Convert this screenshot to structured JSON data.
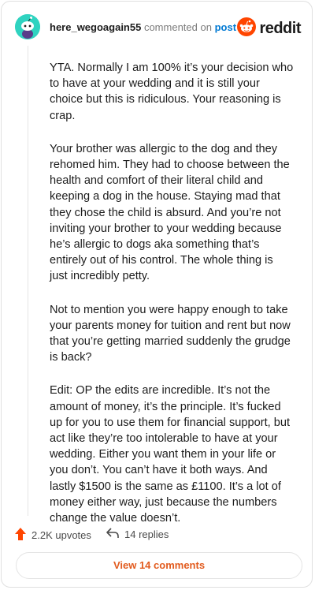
{
  "header": {
    "username": "here_wegoagain55",
    "commented_on": "commented on",
    "post_link": "post",
    "brand": "reddit",
    "avatar_icon": "snoo-avatar-icon",
    "brand_icon": "reddit-logo-icon",
    "colors": {
      "avatar_bg": "#2fd3c0",
      "brand_orange": "#ff4500",
      "link_blue": "#0079d3"
    }
  },
  "comment": {
    "paragraphs": [
      "YTA. Normally I am 100% it’s your decision who to have at your wedding and it is still your choice but this is ridiculous. Your reasoning is crap.",
      "Your brother was allergic to the dog and they rehomed him. They had to choose between the health and comfort of their literal child and keeping a dog in the house. Staying mad that they chose the child is absurd. And you’re not inviting your brother to your wedding because he’s allergic to dogs aka something that’s entirely out of his control. The whole thing is just incredibly petty.",
      "Not to mention you were happy enough to take your parents money for tuition and rent but now that you’re getting married suddenly the grudge is back?",
      "Edit: OP the edits are incredible. It’s not the amount of money, it’s the principle. It’s fucked up for you to use them for financial support, but act like they’re too intolerable to have at your wedding. Either you want them in your life or you don’t. You can’t have it both ways. And lastly $1500 is the same as £1100. It’s a lot of money either way, just because the numbers change the value doesn’t."
    ]
  },
  "footer": {
    "upvotes": "2.2K upvotes",
    "replies": "14 replies",
    "upvote_icon": "upvote-arrow-icon",
    "reply_icon": "reply-arrow-icon",
    "view_comments": "View 14 comments",
    "colors": {
      "upvote": "#ff4500",
      "view_text": "#e25b1e"
    }
  }
}
